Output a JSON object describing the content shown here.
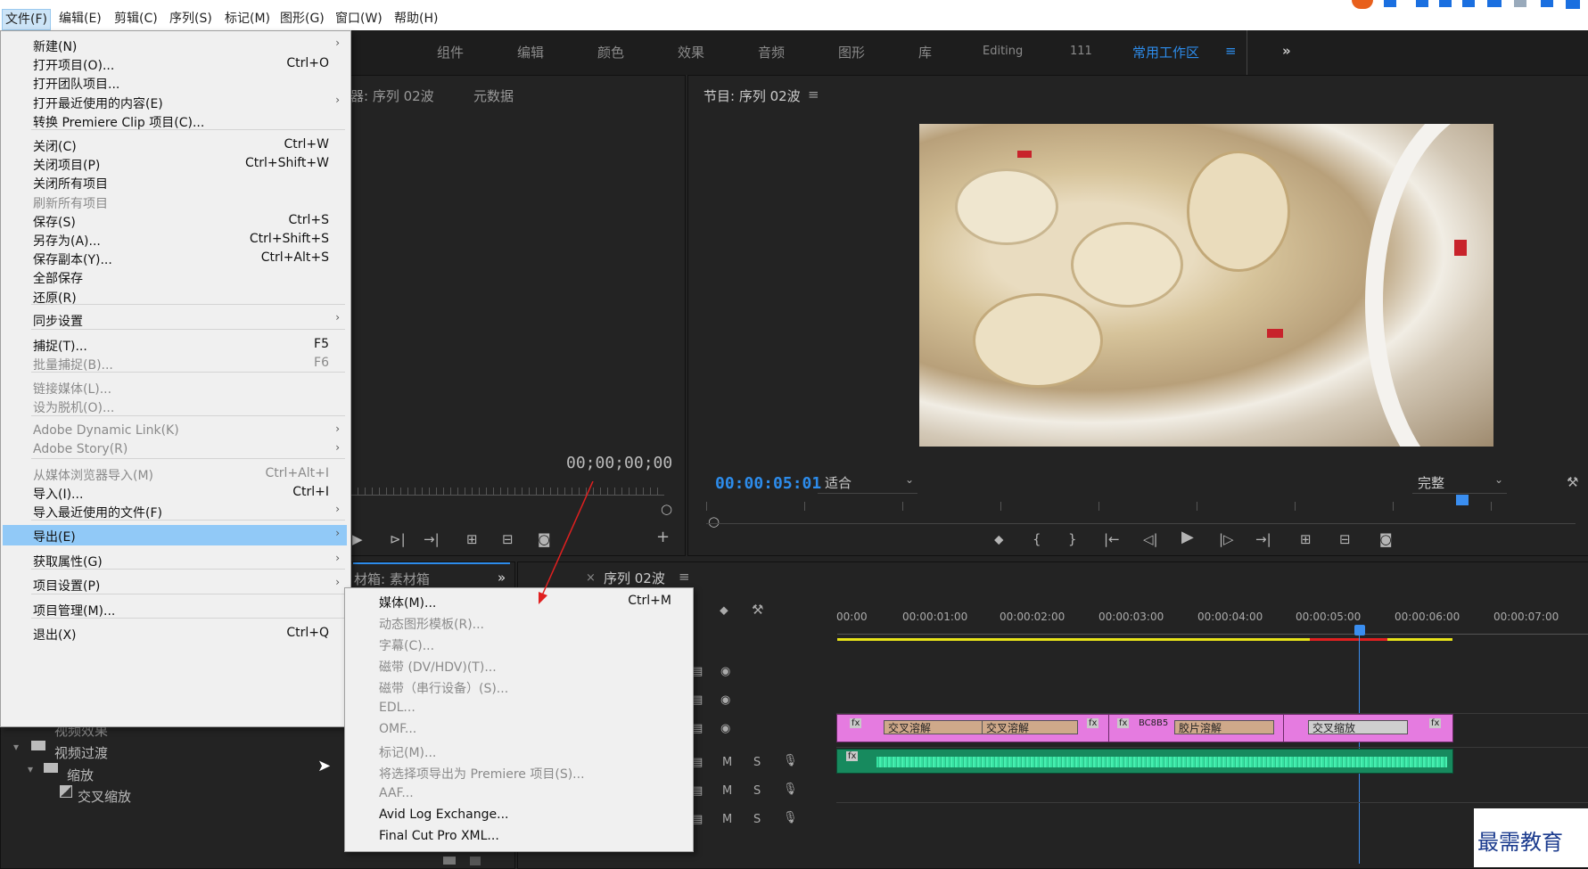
{
  "menubar": {
    "items": [
      "文件(F)",
      "编辑(E)",
      "剪辑(C)",
      "序列(S)",
      "标记(M)",
      "图形(G)",
      "窗口(W)",
      "帮助(H)"
    ]
  },
  "workspaces": {
    "items": [
      "组件",
      "编辑",
      "颜色",
      "效果",
      "音频",
      "图形",
      "库",
      "Editing",
      "111",
      "常用工作区"
    ],
    "more": "»"
  },
  "source_monitor": {
    "tab1": "器: 序列 02波",
    "tab2": "元数据",
    "timecode": "00;00;00;00"
  },
  "program_monitor": {
    "title": "节目: 序列 02波",
    "timecode": "00:00:05:01",
    "fit": "适合",
    "quality": "完整"
  },
  "project_panel": {
    "title": "材箱: 素材箱",
    "tree": [
      "视频效果",
      "视频过渡",
      "缩放",
      "交叉缩放"
    ]
  },
  "timeline": {
    "title": "序列 02波",
    "ruler": [
      "00:00",
      "00:00:01:00",
      "00:00:02:00",
      "00:00:03:00",
      "00:00:04:00",
      "00:00:05:00",
      "00:00:06:00",
      "00:00:07:00"
    ],
    "clips": [
      "交叉溶解",
      "交叉溶解",
      "BC8B5",
      "胶片溶解",
      "交叉缩放"
    ],
    "track_m": "M",
    "track_s": "S",
    "fx": "fx"
  },
  "file_menu": {
    "items": [
      {
        "label": "新建(N)",
        "shortcut": "",
        "arrow": true,
        "disabled": false
      },
      {
        "label": "打开项目(O)...",
        "shortcut": "Ctrl+O",
        "arrow": false,
        "disabled": false
      },
      {
        "label": "打开团队项目...",
        "shortcut": "",
        "arrow": false,
        "disabled": false
      },
      {
        "label": "打开最近使用的内容(E)",
        "shortcut": "",
        "arrow": true,
        "disabled": false
      },
      {
        "label": "转换 Premiere Clip 项目(C)...",
        "shortcut": "",
        "arrow": false,
        "disabled": false
      },
      {
        "label": "关闭(C)",
        "shortcut": "Ctrl+W",
        "arrow": false,
        "disabled": false
      },
      {
        "label": "关闭项目(P)",
        "shortcut": "Ctrl+Shift+W",
        "arrow": false,
        "disabled": false
      },
      {
        "label": "关闭所有项目",
        "shortcut": "",
        "arrow": false,
        "disabled": false
      },
      {
        "label": "刷新所有项目",
        "shortcut": "",
        "arrow": false,
        "disabled": true
      },
      {
        "label": "保存(S)",
        "shortcut": "Ctrl+S",
        "arrow": false,
        "disabled": false
      },
      {
        "label": "另存为(A)...",
        "shortcut": "Ctrl+Shift+S",
        "arrow": false,
        "disabled": false
      },
      {
        "label": "保存副本(Y)...",
        "shortcut": "Ctrl+Alt+S",
        "arrow": false,
        "disabled": false
      },
      {
        "label": "全部保存",
        "shortcut": "",
        "arrow": false,
        "disabled": false
      },
      {
        "label": "还原(R)",
        "shortcut": "",
        "arrow": false,
        "disabled": false
      },
      {
        "label": "同步设置",
        "shortcut": "",
        "arrow": true,
        "disabled": false
      },
      {
        "label": "捕捉(T)...",
        "shortcut": "F5",
        "arrow": false,
        "disabled": false
      },
      {
        "label": "批量捕捉(B)...",
        "shortcut": "F6",
        "arrow": false,
        "disabled": true
      },
      {
        "label": "链接媒体(L)...",
        "shortcut": "",
        "arrow": false,
        "disabled": true
      },
      {
        "label": "设为脱机(O)...",
        "shortcut": "",
        "arrow": false,
        "disabled": true
      },
      {
        "label": "Adobe Dynamic Link(K)",
        "shortcut": "",
        "arrow": true,
        "disabled": true
      },
      {
        "label": "Adobe Story(R)",
        "shortcut": "",
        "arrow": true,
        "disabled": true
      },
      {
        "label": "从媒体浏览器导入(M)",
        "shortcut": "Ctrl+Alt+I",
        "arrow": false,
        "disabled": true
      },
      {
        "label": "导入(I)...",
        "shortcut": "Ctrl+I",
        "arrow": false,
        "disabled": false
      },
      {
        "label": "导入最近使用的文件(F)",
        "shortcut": "",
        "arrow": true,
        "disabled": false
      },
      {
        "label": "导出(E)",
        "shortcut": "",
        "arrow": true,
        "disabled": false,
        "highlight": true
      },
      {
        "label": "获取属性(G)",
        "shortcut": "",
        "arrow": true,
        "disabled": false
      },
      {
        "label": "项目设置(P)",
        "shortcut": "",
        "arrow": true,
        "disabled": false
      },
      {
        "label": "项目管理(M)...",
        "shortcut": "",
        "arrow": false,
        "disabled": false
      },
      {
        "label": "退出(X)",
        "shortcut": "Ctrl+Q",
        "arrow": false,
        "disabled": false
      }
    ]
  },
  "export_submenu": {
    "items": [
      {
        "label": "媒体(M)...",
        "shortcut": "Ctrl+M",
        "disabled": false
      },
      {
        "label": "动态图形模板(R)...",
        "shortcut": "",
        "disabled": true
      },
      {
        "label": "字幕(C)...",
        "shortcut": "",
        "disabled": true
      },
      {
        "label": "磁带 (DV/HDV)(T)...",
        "shortcut": "",
        "disabled": true
      },
      {
        "label": "磁带（串行设备）(S)...",
        "shortcut": "",
        "disabled": true
      },
      {
        "label": "EDL...",
        "shortcut": "",
        "disabled": true
      },
      {
        "label": "OMF...",
        "shortcut": "",
        "disabled": true
      },
      {
        "label": "标记(M)...",
        "shortcut": "",
        "disabled": true
      },
      {
        "label": "将选择项导出为 Premiere 项目(S)...",
        "shortcut": "",
        "disabled": true
      },
      {
        "label": "AAF...",
        "shortcut": "",
        "disabled": true
      },
      {
        "label": "Avid Log Exchange...",
        "shortcut": "",
        "disabled": false
      },
      {
        "label": "Final Cut Pro XML...",
        "shortcut": "",
        "disabled": false
      }
    ]
  },
  "watermark": "最需教育",
  "colors": {
    "accent": "#2d8ceb",
    "highlight": "#91c9f7",
    "clip": "#e57be0",
    "audio": "#2fcf8f",
    "playhead": "#3a8ef0"
  }
}
